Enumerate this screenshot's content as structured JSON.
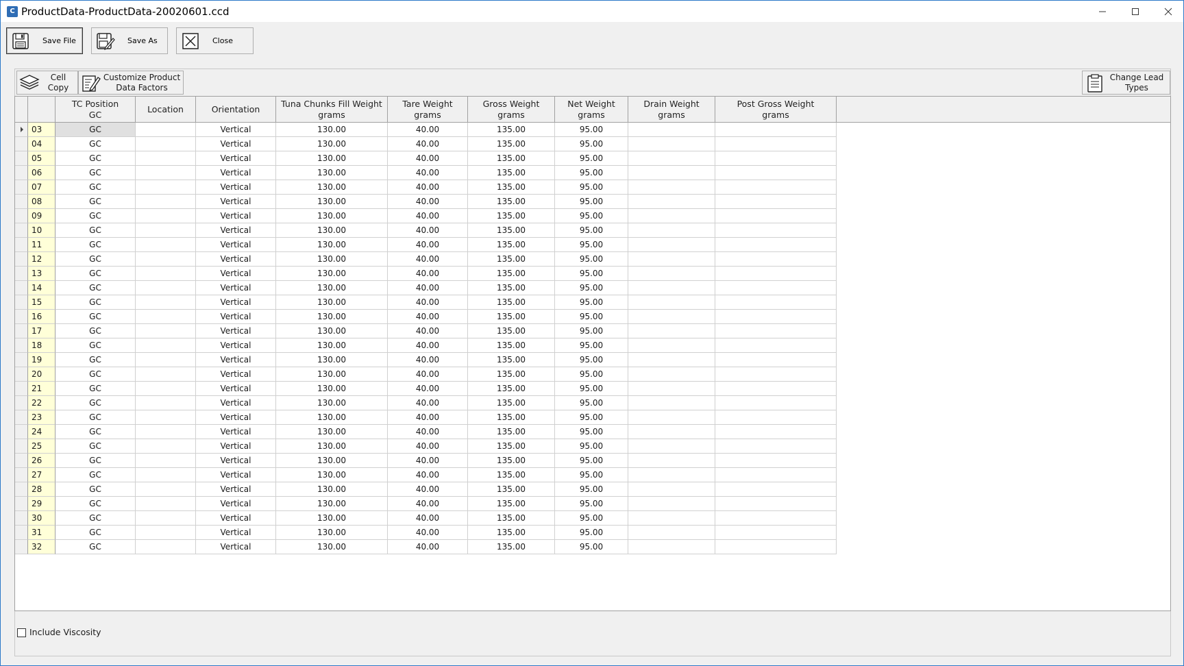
{
  "window": {
    "title": "ProductData-ProductData-20020601.ccd",
    "app_icon_text": "C"
  },
  "toolbar": {
    "save_file": "Save File",
    "save_as": "Save As",
    "close": "Close"
  },
  "grid_toolbar": {
    "cell_copy": "Cell\nCopy",
    "customize": "Customize Product\nData Factors",
    "change_lead": "Change Lead\nTypes"
  },
  "columns": [
    "TC Position\nGC",
    "Location",
    "Orientation",
    "Tuna Chunks Fill Weight\ngrams",
    "Tare Weight\ngrams",
    "Gross Weight\ngrams",
    "Net Weight\ngrams",
    "Drain Weight\ngrams",
    "Post Gross Weight\ngrams"
  ],
  "rows": [
    [
      "03",
      "GC",
      "",
      "Vertical",
      "130.00",
      "40.00",
      "135.00",
      "95.00",
      "",
      ""
    ],
    [
      "04",
      "GC",
      "",
      "Vertical",
      "130.00",
      "40.00",
      "135.00",
      "95.00",
      "",
      ""
    ],
    [
      "05",
      "GC",
      "",
      "Vertical",
      "130.00",
      "40.00",
      "135.00",
      "95.00",
      "",
      ""
    ],
    [
      "06",
      "GC",
      "",
      "Vertical",
      "130.00",
      "40.00",
      "135.00",
      "95.00",
      "",
      ""
    ],
    [
      "07",
      "GC",
      "",
      "Vertical",
      "130.00",
      "40.00",
      "135.00",
      "95.00",
      "",
      ""
    ],
    [
      "08",
      "GC",
      "",
      "Vertical",
      "130.00",
      "40.00",
      "135.00",
      "95.00",
      "",
      ""
    ],
    [
      "09",
      "GC",
      "",
      "Vertical",
      "130.00",
      "40.00",
      "135.00",
      "95.00",
      "",
      ""
    ],
    [
      "10",
      "GC",
      "",
      "Vertical",
      "130.00",
      "40.00",
      "135.00",
      "95.00",
      "",
      ""
    ],
    [
      "11",
      "GC",
      "",
      "Vertical",
      "130.00",
      "40.00",
      "135.00",
      "95.00",
      "",
      ""
    ],
    [
      "12",
      "GC",
      "",
      "Vertical",
      "130.00",
      "40.00",
      "135.00",
      "95.00",
      "",
      ""
    ],
    [
      "13",
      "GC",
      "",
      "Vertical",
      "130.00",
      "40.00",
      "135.00",
      "95.00",
      "",
      ""
    ],
    [
      "14",
      "GC",
      "",
      "Vertical",
      "130.00",
      "40.00",
      "135.00",
      "95.00",
      "",
      ""
    ],
    [
      "15",
      "GC",
      "",
      "Vertical",
      "130.00",
      "40.00",
      "135.00",
      "95.00",
      "",
      ""
    ],
    [
      "16",
      "GC",
      "",
      "Vertical",
      "130.00",
      "40.00",
      "135.00",
      "95.00",
      "",
      ""
    ],
    [
      "17",
      "GC",
      "",
      "Vertical",
      "130.00",
      "40.00",
      "135.00",
      "95.00",
      "",
      ""
    ],
    [
      "18",
      "GC",
      "",
      "Vertical",
      "130.00",
      "40.00",
      "135.00",
      "95.00",
      "",
      ""
    ],
    [
      "19",
      "GC",
      "",
      "Vertical",
      "130.00",
      "40.00",
      "135.00",
      "95.00",
      "",
      ""
    ],
    [
      "20",
      "GC",
      "",
      "Vertical",
      "130.00",
      "40.00",
      "135.00",
      "95.00",
      "",
      ""
    ],
    [
      "21",
      "GC",
      "",
      "Vertical",
      "130.00",
      "40.00",
      "135.00",
      "95.00",
      "",
      ""
    ],
    [
      "22",
      "GC",
      "",
      "Vertical",
      "130.00",
      "40.00",
      "135.00",
      "95.00",
      "",
      ""
    ],
    [
      "23",
      "GC",
      "",
      "Vertical",
      "130.00",
      "40.00",
      "135.00",
      "95.00",
      "",
      ""
    ],
    [
      "24",
      "GC",
      "",
      "Vertical",
      "130.00",
      "40.00",
      "135.00",
      "95.00",
      "",
      ""
    ],
    [
      "25",
      "GC",
      "",
      "Vertical",
      "130.00",
      "40.00",
      "135.00",
      "95.00",
      "",
      ""
    ],
    [
      "26",
      "GC",
      "",
      "Vertical",
      "130.00",
      "40.00",
      "135.00",
      "95.00",
      "",
      ""
    ],
    [
      "27",
      "GC",
      "",
      "Vertical",
      "130.00",
      "40.00",
      "135.00",
      "95.00",
      "",
      ""
    ],
    [
      "28",
      "GC",
      "",
      "Vertical",
      "130.00",
      "40.00",
      "135.00",
      "95.00",
      "",
      ""
    ],
    [
      "29",
      "GC",
      "",
      "Vertical",
      "130.00",
      "40.00",
      "135.00",
      "95.00",
      "",
      ""
    ],
    [
      "30",
      "GC",
      "",
      "Vertical",
      "130.00",
      "40.00",
      "135.00",
      "95.00",
      "",
      ""
    ],
    [
      "31",
      "GC",
      "",
      "Vertical",
      "130.00",
      "40.00",
      "135.00",
      "95.00",
      "",
      ""
    ],
    [
      "32",
      "GC",
      "",
      "Vertical",
      "130.00",
      "40.00",
      "135.00",
      "95.00",
      "",
      ""
    ]
  ],
  "footer": {
    "include_viscosity": "Include Viscosity",
    "include_viscosity_checked": false
  }
}
